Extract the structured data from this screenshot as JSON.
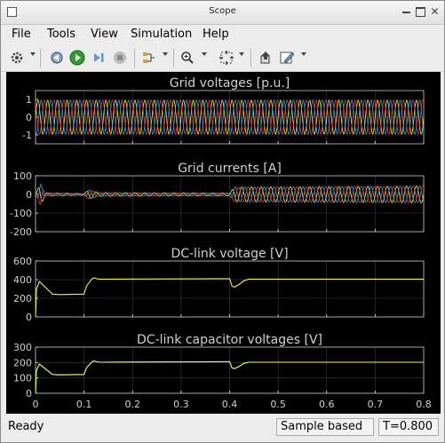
{
  "window": {
    "title": "Scope"
  },
  "menu": [
    "File",
    "Tools",
    "View",
    "Simulation",
    "Help"
  ],
  "toolbar_icons": [
    "gear-icon",
    "step-back-icon",
    "run-icon",
    "step-forward-icon",
    "stop-icon",
    "highlight-icon",
    "zoom-in-icon",
    "fit-to-view-icon",
    "restore-icon",
    "style-icon"
  ],
  "status": {
    "left": "Ready",
    "mode": "Sample based",
    "time": "T=0.800"
  },
  "colors": {
    "background": "#000000",
    "axes": "#c8c8c8",
    "yellow": "#f5f243",
    "blue": "#2aa9f2",
    "red": "#ef3d3d",
    "text": "#d0d0d0"
  },
  "chart_data": [
    {
      "type": "line",
      "title": "Grid voltages [p.u.]",
      "ylim": [
        -1.5,
        1.5
      ],
      "yticks": [
        "1",
        "0",
        "-1"
      ],
      "ytick_values": [
        1,
        0,
        -1
      ],
      "xlim": [
        0,
        0.8
      ],
      "series": [
        {
          "color": "yellow",
          "x": [
            0,
            0.8
          ],
          "amplitude": 0.95,
          "form": "three-phase sinusoid"
        },
        {
          "color": "blue",
          "x": [
            0,
            0.8
          ],
          "amplitude": 0.95,
          "form": "three-phase sinusoid"
        },
        {
          "color": "red",
          "x": [
            0,
            0.8
          ],
          "amplitude": 0.95,
          "form": "three-phase sinusoid"
        }
      ]
    },
    {
      "type": "line",
      "title": "Grid currents [A]",
      "ylim": [
        -200,
        100
      ],
      "yticks": [
        "100",
        "0",
        "-100",
        "-200"
      ],
      "ytick_values": [
        100,
        0,
        -100,
        -200
      ],
      "xlim": [
        0,
        0.8
      ],
      "envelope": {
        "x": [
          0,
          0.01,
          0.02,
          0.1,
          0.11,
          0.13,
          0.38,
          0.4,
          0.41,
          0.43,
          0.8
        ],
        "amp": [
          0,
          60,
          8,
          5,
          25,
          10,
          8,
          8,
          40,
          40,
          45
        ]
      },
      "series": [
        {
          "color": "yellow"
        },
        {
          "color": "blue"
        },
        {
          "color": "red"
        }
      ]
    },
    {
      "type": "line",
      "title": "DC-link voltage [V]",
      "ylim": [
        0,
        600
      ],
      "yticks": [
        "600",
        "400",
        "200",
        "0"
      ],
      "ytick_values": [
        600,
        400,
        200,
        0
      ],
      "xlim": [
        0,
        0.8
      ],
      "series": [
        {
          "color": "yellow",
          "x": [
            0,
            0.002,
            0.008,
            0.02,
            0.035,
            0.05,
            0.1,
            0.105,
            0.115,
            0.12,
            0.13,
            0.4,
            0.405,
            0.41,
            0.42,
            0.43,
            0.44,
            0.8
          ],
          "y": [
            0,
            300,
            380,
            320,
            245,
            240,
            245,
            330,
            400,
            420,
            405,
            410,
            330,
            320,
            350,
            390,
            405,
            405
          ]
        }
      ]
    },
    {
      "type": "line",
      "title": "DC-link capacitor voltages [V]",
      "ylim": [
        0,
        300
      ],
      "yticks": [
        "300",
        "200",
        "100",
        "0"
      ],
      "ytick_values": [
        300,
        200,
        100,
        0
      ],
      "xlim": [
        0,
        0.8
      ],
      "xticks": [
        "0",
        "0.1",
        "0.2",
        "0.3",
        "0.4",
        "0.5",
        "0.6",
        "0.7",
        "0.8"
      ],
      "xtick_values": [
        0,
        0.1,
        0.2,
        0.3,
        0.4,
        0.5,
        0.6,
        0.7,
        0.8
      ],
      "series": [
        {
          "color": "blue",
          "x": [
            0,
            0.002,
            0.008,
            0.02,
            0.035,
            0.05,
            0.1,
            0.105,
            0.115,
            0.12,
            0.13,
            0.4,
            0.405,
            0.41,
            0.42,
            0.43,
            0.44,
            0.8
          ],
          "y": [
            0,
            150,
            190,
            160,
            122,
            120,
            122,
            165,
            200,
            210,
            202,
            205,
            165,
            160,
            175,
            195,
            202,
            202
          ]
        },
        {
          "color": "yellow",
          "x": [
            0,
            0.002,
            0.008,
            0.02,
            0.035,
            0.05,
            0.1,
            0.105,
            0.115,
            0.12,
            0.13,
            0.4,
            0.405,
            0.41,
            0.42,
            0.43,
            0.44,
            0.8
          ],
          "y": [
            0,
            150,
            190,
            160,
            122,
            120,
            122,
            165,
            200,
            210,
            202,
            205,
            165,
            160,
            175,
            195,
            202,
            202
          ]
        }
      ]
    }
  ]
}
